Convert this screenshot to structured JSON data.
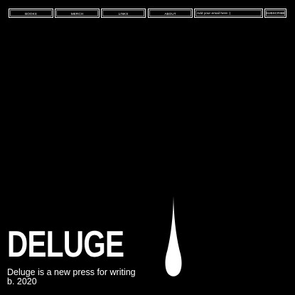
{
  "nav": {
    "items": [
      {
        "label": "BOOKS"
      },
      {
        "label": "MERCH"
      },
      {
        "label": "LINKS"
      },
      {
        "label": "ABOUT"
      }
    ],
    "email_placeholder": "Add your email here :)",
    "subscribe_label": "SUBSCRIBE"
  },
  "hero": {
    "title": "DELUGE",
    "tagline_line1": "Deluge is a new press for writing",
    "tagline_line2": "b. 2020"
  },
  "colors": {
    "background": "#000000",
    "foreground": "#ffffff"
  },
  "icons": {
    "drop": "raindrop-icon"
  }
}
